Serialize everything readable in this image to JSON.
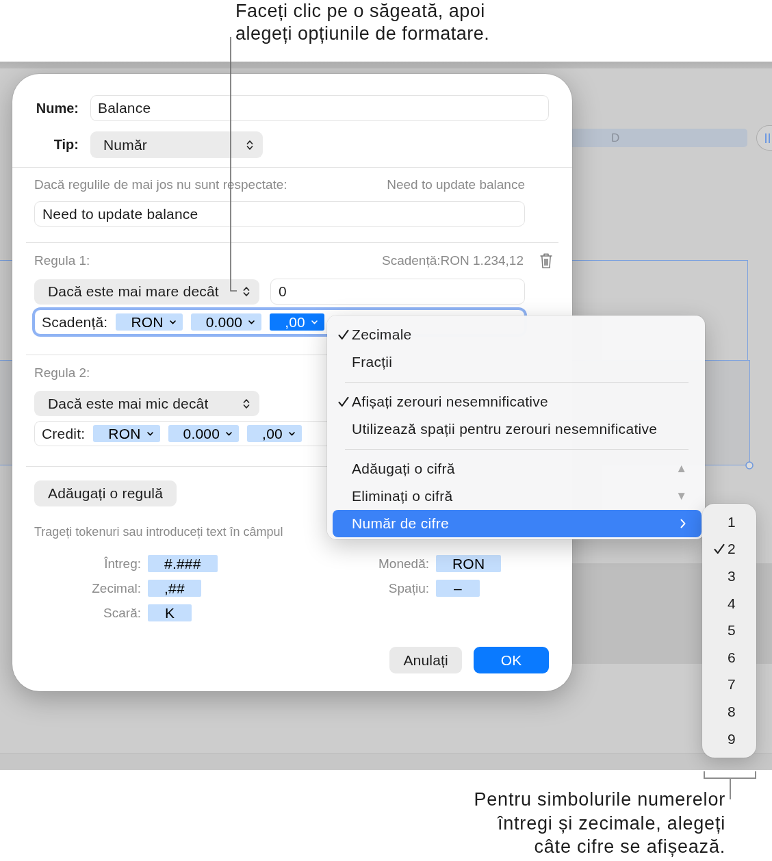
{
  "callouts": [
    {
      "kind": "top",
      "text": "Faceți clic pe o săgeată, apoi alegeți opțiunile de formatare."
    },
    {
      "kind": "bottom",
      "text": "Pentru simbolurile numerelor întregi și zecimale, alegeți câte cifre se afișează."
    }
  ],
  "background": {
    "column_header": "D"
  },
  "dialog": {
    "name": {
      "label": "Nume:",
      "value": "Balance"
    },
    "type": {
      "label": "Tip:",
      "value": "Număr"
    },
    "fallback": {
      "label": "Dacă regulile de mai jos nu sunt respectate:",
      "preview": "Need to update balance",
      "value": "Need to update balance"
    },
    "rules": [
      {
        "title": "Regula 1:",
        "preview": "Scadență:RON 1.234,12",
        "condition": "Dacă este mai mare decât",
        "value": "0",
        "focused": true,
        "format": {
          "label": "Scadență:",
          "tokens": [
            {
              "label": "RON",
              "selected": false
            },
            {
              "label": "0.000",
              "selected": false
            },
            {
              "label": ",00",
              "selected": true
            }
          ]
        }
      },
      {
        "title": "Regula 2:",
        "condition": "Dacă este mai mic decât",
        "focused": false,
        "format": {
          "label": "Credit:",
          "tokens": [
            {
              "label": "RON",
              "selected": false
            },
            {
              "label": "0.000",
              "selected": false
            },
            {
              "label": ",00",
              "selected": false
            }
          ]
        }
      }
    ],
    "add_rule_button": "Adăugați o regulă",
    "hint": "Trageți tokenuri sau introduceți text în câmpul",
    "token_columns": [
      [
        {
          "label": "Întreg:",
          "token": "#.###"
        },
        {
          "label": "Zecimal:",
          "token": ",##"
        },
        {
          "label": "Scară:",
          "token": "K"
        }
      ],
      [
        {
          "label": "Monedă:",
          "token": "RON"
        },
        {
          "label": "Spațiu:",
          "token": "–"
        }
      ]
    ],
    "buttons": [
      {
        "label": "Anulați",
        "kind": "secondary"
      },
      {
        "label": "OK",
        "kind": "primary"
      }
    ]
  },
  "format_menu": {
    "sections": [
      [
        {
          "kind": "check",
          "label": "Zecimale",
          "checked": true,
          "selected": false
        },
        {
          "kind": "check",
          "label": "Fracții",
          "checked": false,
          "selected": false
        }
      ],
      [
        {
          "kind": "check",
          "label": "Afișați zerouri nesemnificative",
          "checked": true,
          "selected": false
        },
        {
          "kind": "check",
          "label": "Utilizează spații pentru zerouri nesemnificative",
          "checked": false,
          "selected": false
        }
      ],
      [
        {
          "kind": "step",
          "label": "Adăugați o cifră",
          "shortcut": "▲",
          "selected": false
        },
        {
          "kind": "step",
          "label": "Eliminați o cifră",
          "shortcut": "▼",
          "selected": false
        },
        {
          "kind": "submenu",
          "label": "Număr de cifre",
          "selected": true
        }
      ]
    ]
  },
  "digits_menu": {
    "items": [
      {
        "label": "1",
        "checked": false
      },
      {
        "label": "2",
        "checked": true
      },
      {
        "label": "3",
        "checked": false
      },
      {
        "label": "4",
        "checked": false
      },
      {
        "label": "5",
        "checked": false
      },
      {
        "label": "6",
        "checked": false
      },
      {
        "label": "7",
        "checked": false
      },
      {
        "label": "8",
        "checked": false
      },
      {
        "label": "9",
        "checked": false
      }
    ]
  }
}
